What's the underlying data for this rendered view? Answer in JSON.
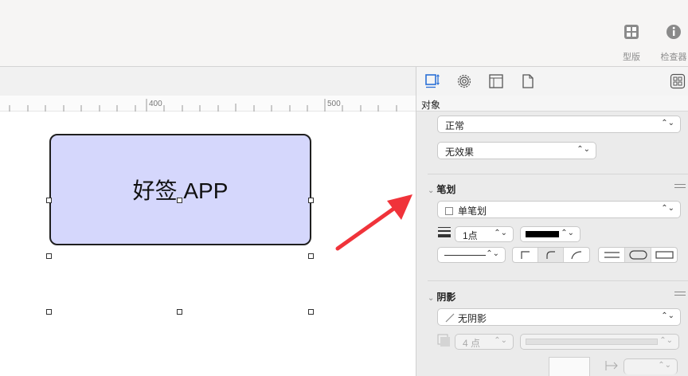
{
  "toolbar": {
    "stencils_label": "型版",
    "inspector_label": "检查器"
  },
  "ruler": {
    "mark_400": "400",
    "mark_500": "500"
  },
  "canvas": {
    "shape_text": "好签 APP"
  },
  "inspector": {
    "header_title": "对象",
    "blend_mode": "正常",
    "effect": "无效果",
    "stroke_section": {
      "title": "笔划",
      "stroke_type": "单笔划",
      "weight": "1点",
      "color": "#000000"
    },
    "shadow_section": {
      "title": "阴影",
      "shadow_type": "无阴影",
      "size": "4 点"
    }
  },
  "annotation": {
    "arrow_color": "#f0333a"
  }
}
